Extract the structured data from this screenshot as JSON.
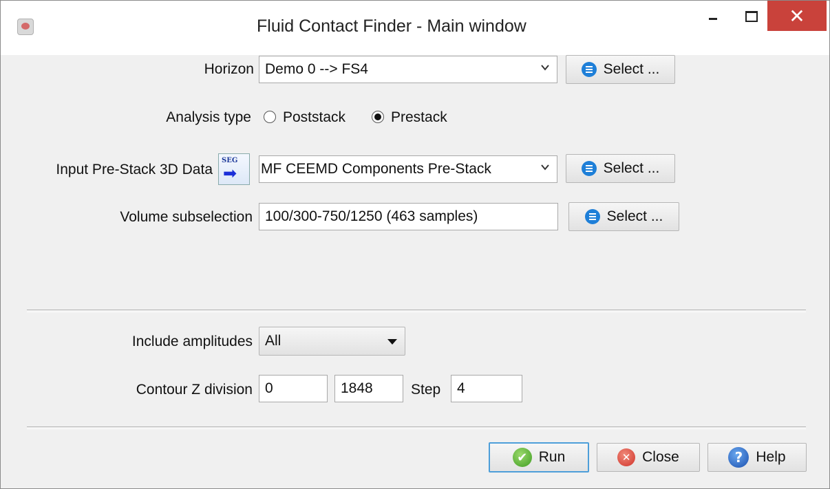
{
  "window": {
    "title": "Fluid Contact Finder - Main window",
    "close_glyph": "✕"
  },
  "horizon": {
    "label": "Horizon",
    "value": "Demo 0 --> FS4",
    "select_label": "Select ..."
  },
  "analysis": {
    "label": "Analysis type",
    "options": [
      {
        "label": "Poststack",
        "selected": false
      },
      {
        "label": "Prestack",
        "selected": true
      }
    ]
  },
  "input": {
    "label": "Input Pre-Stack 3D Data",
    "icon_text": "SEG",
    "value": "MF CEEMD Components Pre-Stack",
    "select_label": "Select ..."
  },
  "volume": {
    "label": "Volume subselection",
    "value": "100/300-750/1250 (463 samples)",
    "select_label": "Select ..."
  },
  "amplitudes": {
    "label": "Include amplitudes",
    "value": "All"
  },
  "contour": {
    "label": "Contour Z division",
    "start": "0",
    "stop": "1848",
    "step_label": "Step",
    "step": "4"
  },
  "buttons": {
    "run": "Run",
    "close": "Close",
    "help": "Help",
    "check_glyph": "✔",
    "x_glyph": "✕",
    "help_glyph": "?"
  }
}
